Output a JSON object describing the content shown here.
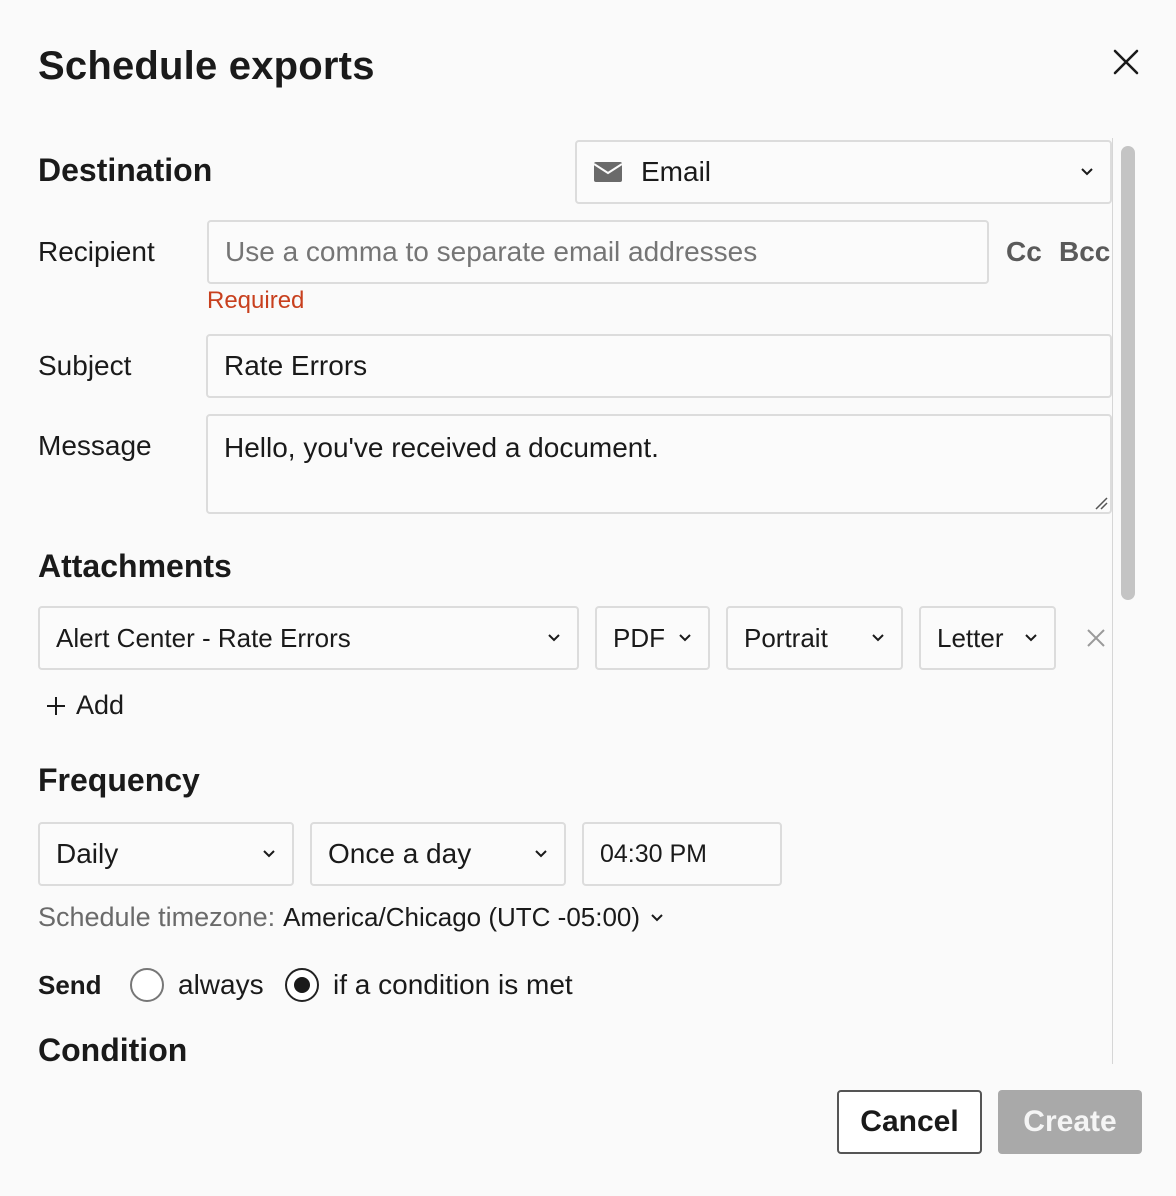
{
  "dialog": {
    "title": "Schedule exports"
  },
  "destination": {
    "heading": "Destination",
    "type": "Email",
    "type_icon": "envelope-icon"
  },
  "recipient": {
    "label": "Recipient",
    "placeholder": "Use a comma to separate email addresses",
    "value": "",
    "error": "Required",
    "cc": "Cc",
    "bcc": "Bcc"
  },
  "subject": {
    "label": "Subject",
    "value": "Rate Errors"
  },
  "message": {
    "label": "Message",
    "value": "Hello, you've received a document."
  },
  "attachments": {
    "heading": "Attachments",
    "items": [
      {
        "report": "Alert Center - Rate Errors",
        "format": "PDF",
        "orientation": "Portrait",
        "paper": "Letter"
      }
    ],
    "add_label": "Add"
  },
  "frequency": {
    "heading": "Frequency",
    "period": "Daily",
    "repeat": "Once a day",
    "time": "04:30 PM",
    "timezone_label": "Schedule timezone:",
    "timezone_value": "America/Chicago (UTC -05:00)"
  },
  "send": {
    "label": "Send",
    "options": [
      "always",
      "if a condition is met"
    ],
    "selected": "if a condition is met"
  },
  "condition": {
    "heading": "Condition"
  },
  "footer": {
    "cancel_label": "Cancel",
    "create_label": "Create"
  },
  "colors": {
    "error": "#c8401e",
    "disabled_button": "#a9a9a9"
  }
}
